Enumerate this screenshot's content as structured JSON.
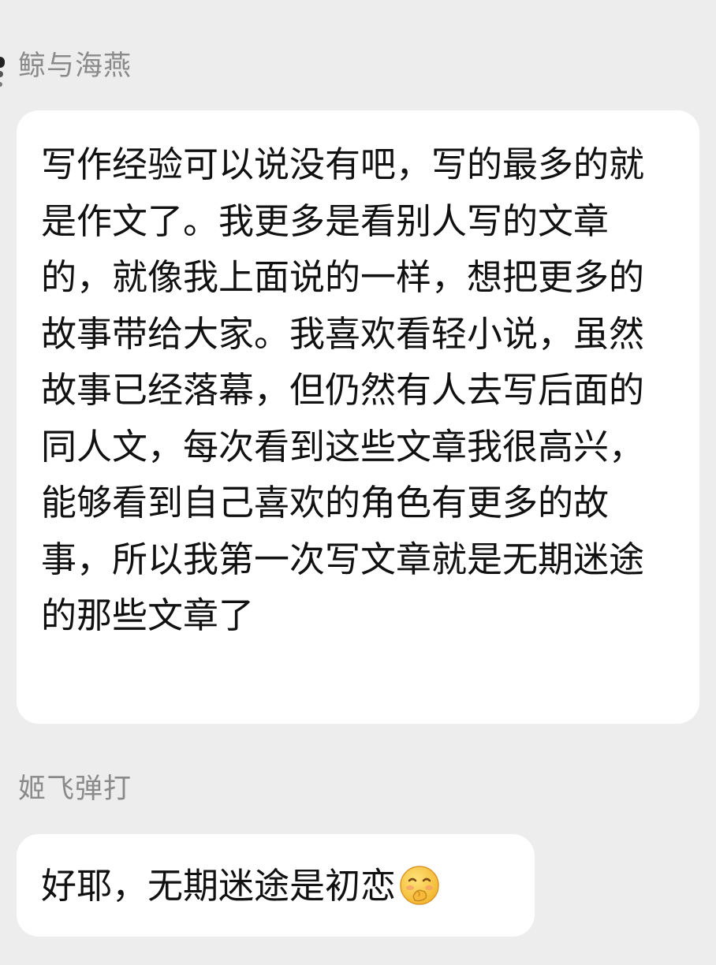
{
  "messages": [
    {
      "sender": "鲸与海燕",
      "text": "写作经验可以说没有吧，写的最多的就是作文了。我更多是看别人写的文章的，就像我上面说的一样，想把更多的故事带给大家。我喜欢看轻小说，虽然故事已经落幕，但仍然有人去写后面的同人文，每次看到这些文章我很高兴，能够看到自己喜欢的角色有更多的故事，所以我第一次写文章就是无期迷途的那些文章了"
    },
    {
      "sender": "姬飞弹打",
      "text": "好耶，无期迷途是初恋",
      "emoji": "shy-smile-emoji"
    }
  ],
  "colors": {
    "background": "#ededed",
    "bubble": "#ffffff",
    "sender_name": "#8a8a8a",
    "message_text": "#111111",
    "emoji_face": "#f8c53a"
  }
}
